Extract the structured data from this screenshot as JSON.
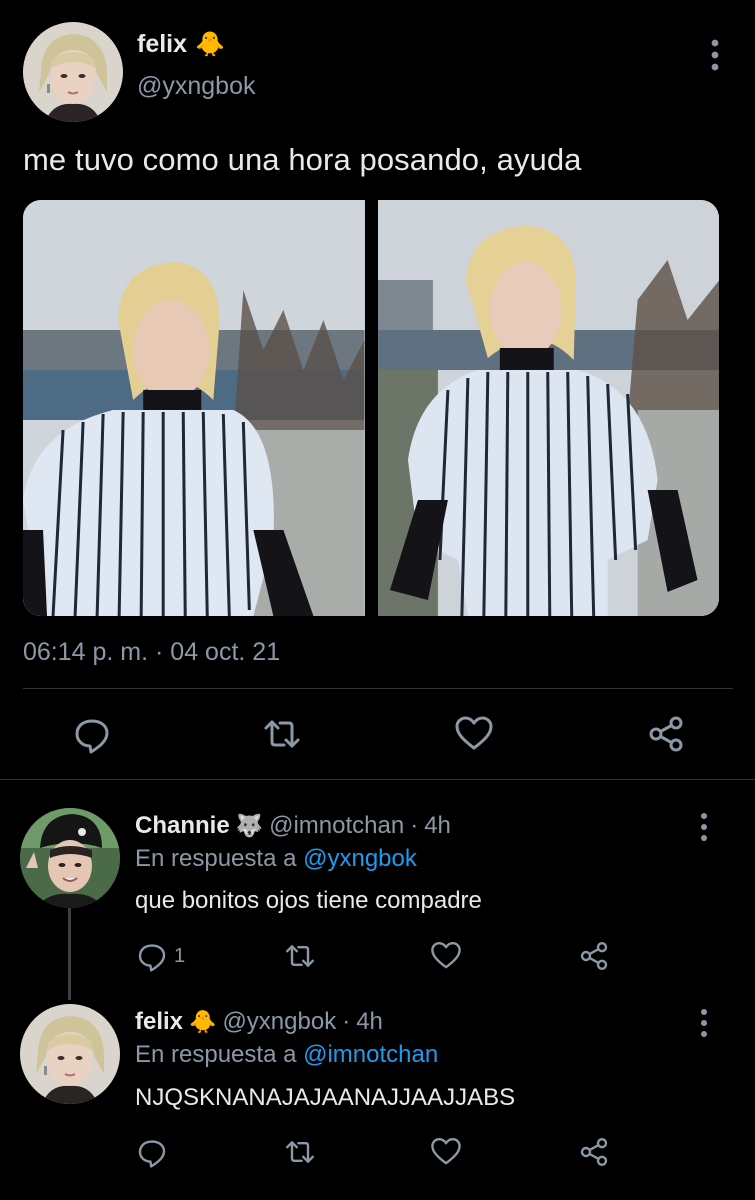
{
  "main_tweet": {
    "author_name": "felix",
    "author_emoji": "🐥",
    "author_handle": "@yxngbok",
    "text": "me tuvo como una hora posando, ayuda",
    "timestamp": "06:14 p. m. · 04 oct. 21",
    "actions": [
      "reply-icon",
      "retweet-icon",
      "like-icon",
      "share-icon"
    ]
  },
  "replies": [
    {
      "author_name": "Channie",
      "author_emoji": "🐺",
      "author_handle": "@imnotchan",
      "separator": "·",
      "time": "4h",
      "in_reply_prefix": "En respuesta a",
      "in_reply_to": "@yxngbok",
      "text": "que bonitos ojos tiene compadre",
      "reply_count": "1"
    },
    {
      "author_name": "felix",
      "author_emoji": "🐥",
      "author_handle": "@yxngbok",
      "separator": "·",
      "time": "4h",
      "in_reply_prefix": "En respuesta a",
      "in_reply_to": "@imnotchan",
      "text": "NJQSKNANAJAJAANAJJAAJJABS",
      "reply_count": ""
    }
  ],
  "colors": {
    "background": "#000000",
    "text": "#e7e9ea",
    "secondary": "#8b98a5",
    "accent": "#1d9bf0",
    "divider": "#2f3336"
  }
}
